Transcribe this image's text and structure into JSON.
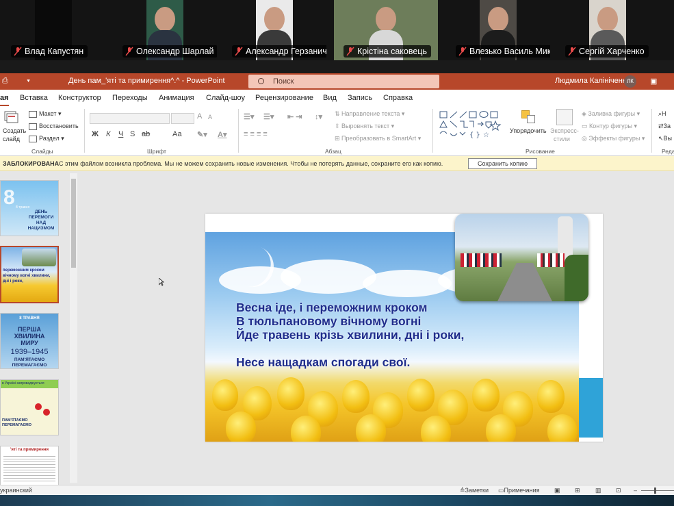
{
  "participants": [
    {
      "name": "Влад Капустян"
    },
    {
      "name": "Олександр Шарлай"
    },
    {
      "name": "Александр Герзанич"
    },
    {
      "name": "Крістіна  саковець"
    },
    {
      "name": "Влезько Василь Мик..."
    },
    {
      "name": "Сергій Харченко"
    }
  ],
  "titlebar": {
    "doc_title": "День пам_'яті та примирення^.^  -  PowerPoint",
    "search_placeholder": "Поиск",
    "user_name": "Людмила Калініченко",
    "user_initials": "ЛК"
  },
  "tabs": [
    "ая",
    "Вставка",
    "Конструктор",
    "Переходы",
    "Анимация",
    "Слайд-шоу",
    "Рецензирование",
    "Вид",
    "Запись",
    "Справка"
  ],
  "ribbon": {
    "slides_group": {
      "new_slide": "Создать",
      "new_slide_2": "слайд",
      "layout": "Макет",
      "reset": "Восстановить",
      "section": "Раздел",
      "label": "Слайды"
    },
    "font_group": {
      "bold": "Ж",
      "italic": "К",
      "underline": "Ч",
      "strike": "S",
      "spacing": "ab",
      "case": "Аа",
      "grow": "A",
      "shrink": "A",
      "label": "Шрифт"
    },
    "paragraph_group": {
      "direction": "Направление текста",
      "align": "Выровнять текст",
      "smartart": "Преобразовать в SmartArt",
      "label": "Абзац"
    },
    "drawing_group": {
      "arrange": "Упорядочить",
      "quick_styles": "Экспресс-",
      "quick_styles_2": "стили",
      "fill": "Заливка фигуры",
      "outline": "Контур фигуры",
      "effects": "Эффекты фигуры",
      "label": "Рисование"
    },
    "editing_group": {
      "find": "Н",
      "replace": "За",
      "select": "Вы",
      "label": "Реда"
    }
  },
  "notice": {
    "state": "ЗАБЛОКИРОВАНА",
    "message": "С этим файлом возникла проблема. Мы не можем сохранить новые изменения. Чтобы не потерять данные, сохраните его как копию.",
    "button": "Сохранить копию"
  },
  "thumbnails": [
    {
      "text": "ДЕНЬ ПЕРЕМОГИ НАД НАЦИЗМОМ",
      "sub": "8 травня"
    },
    {
      "text": "переможним кроком вічному вогні хвилини, дні і роки,"
    },
    {
      "text": "ПЕРША ХВИЛИНА МИРУ",
      "sub": "8 ТРАВНЯ",
      "years": "1939–1945",
      "sub2": "ПАМ'ЯТАЄМО ПЕРЕМАГАЄМО"
    },
    {
      "text": "в Україні запроваджується",
      "sub": "ПАМ'ЯТАЄМО ПЕРЕМАГАЄМО"
    },
    {
      "text": "'яті та примирення"
    }
  ],
  "slide": {
    "poem_lines": [
      "Весна іде, і переможним кроком",
      "В тюльпановому вічному вогні",
      "Йде травень крізь хвилини, дні і роки,",
      "",
      "Несе нащадкам спогади свої."
    ]
  },
  "status": {
    "language": "украинский",
    "notes": "Заметки",
    "comments": "Примечания"
  },
  "colors": {
    "accent": "#b7472a",
    "poem_text": "#1f2d8c",
    "notice_bg": "#fcf4cb"
  }
}
